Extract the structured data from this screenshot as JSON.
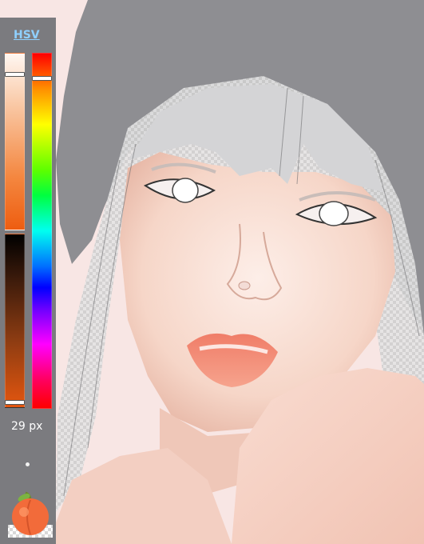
{
  "toolbar": {
    "mode_tab": "HSV",
    "brush_size": "29 px",
    "icons": {
      "brush_preview": "peach-icon",
      "size_dot": "brush-size-dot-icon"
    }
  },
  "colors": {
    "panel": "#7b7b7f",
    "mode_tab": "#8fd0ff",
    "current_color": "#ee5d10",
    "canvas_background": "#8e8e92",
    "skin": "#f8dcd2",
    "hair": "#d9d9d9",
    "lips": "#f08a72"
  },
  "sliders": {
    "saturation_level": 0.12,
    "brightness_level": 0.97,
    "hue_level": 0.07
  }
}
